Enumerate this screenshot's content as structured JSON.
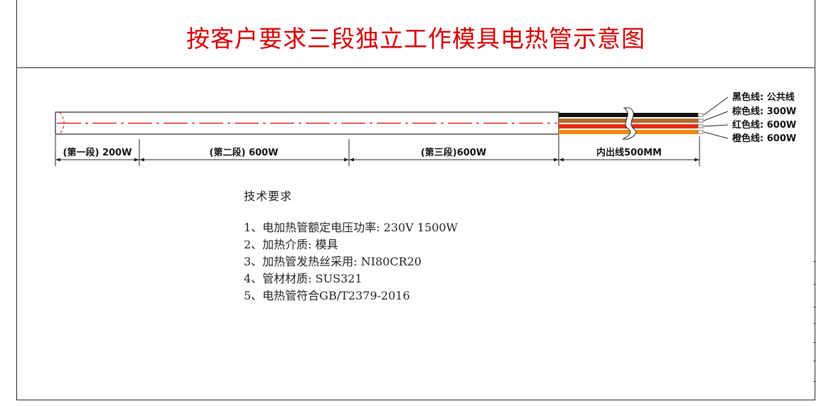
{
  "title": "按客户要求三段独立工作模具电热管示意图",
  "dimensions": {
    "segment1": "(第一段) 200W",
    "segment2": "(第二段) 600W",
    "segment3": "(第三段)600W",
    "lead": "内出线500MM"
  },
  "wires": [
    {
      "label": "黑色线: 公共线",
      "color": "#111111"
    },
    {
      "label": "棕色线: 300W",
      "color": "#b06a2a"
    },
    {
      "label": "红色线: 600W",
      "color": "#e52a10"
    },
    {
      "label": "橙色线: 600W",
      "color": "#f08a10"
    }
  ],
  "requirements": {
    "heading": "技术要求",
    "items": [
      "1、电加热管额定电压功率: 230V 1500W",
      "2、加热介质: 模具",
      "3、加热管发热丝采用: NI80CR20",
      "4、管材材质: SUS321",
      "5、电热管符合GB/T2379-2016"
    ]
  }
}
